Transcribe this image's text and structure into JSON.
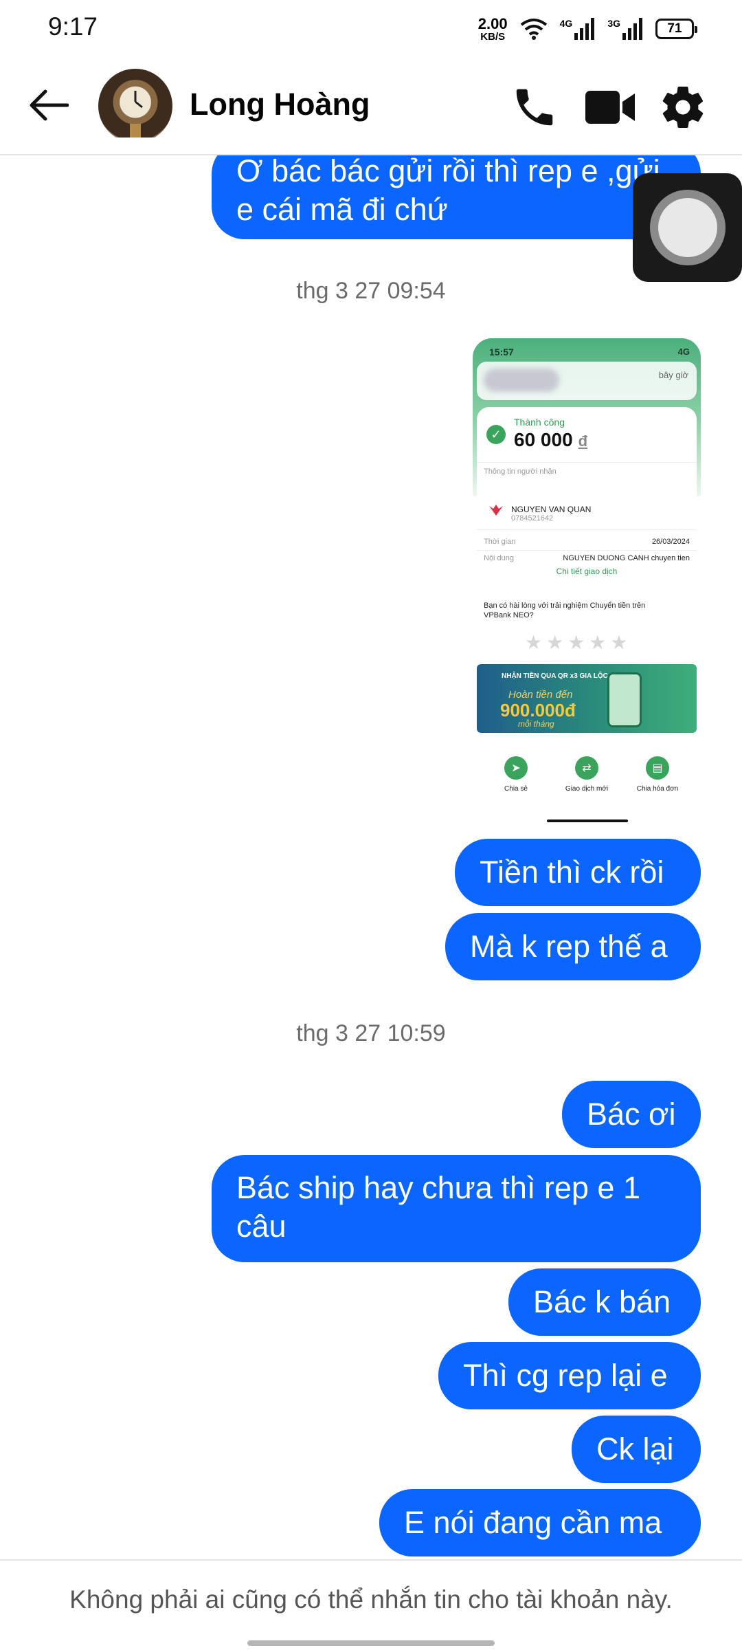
{
  "status_bar": {
    "time": "9:17",
    "net_speed_value": "2.00",
    "net_speed_unit": "KB/S",
    "signal_1": "4G",
    "signal_2": "3G",
    "battery": "71"
  },
  "header": {
    "contact_name": "Long Hoàng",
    "icons": [
      "back-arrow-icon",
      "phone-icon",
      "video-camera-icon",
      "gear-icon"
    ]
  },
  "messages": {
    "m1": {
      "line1": "Ơ bác bác gửi rồi thì rep e ,gửi",
      "line2": "e cái mã đi chứ"
    },
    "ts1": "thg 3 27 09:54",
    "attachment": {
      "status_time": "15:57",
      "status_network": "4G",
      "notif_ago": "bây giờ",
      "status": "Thành công",
      "amount": "60 000",
      "currency": "đ",
      "recipient_label": "Thông tin người nhận",
      "recipient_name": "NGUYEN VAN QUAN",
      "recipient_phone": "0784521642",
      "time_label": "Thời gian",
      "time_value": "26/03/2024",
      "content_label": "Nội dung",
      "content_value": "NGUYEN DUONG CANH chuyen tien",
      "detail_link": "Chi tiết giao dịch",
      "rating_question": "Bạn có hài lòng với trải nghiệm Chuyển tiền trên VPBank NEO?",
      "stars": "★★★★★",
      "banner_line1": "NHẬN TIỀN QUA QR x3 GIA LỘC",
      "banner_line2": "Hoàn tiền đến",
      "banner_amount": "900.000đ",
      "banner_line4": "mỗi tháng",
      "action_share": "Chia sẻ",
      "action_new": "Giao dịch mới",
      "action_split": "Chia hóa đơn"
    },
    "m2": "Tiền thì ck rồi",
    "m3": "Mà k rep thế a",
    "ts2": "thg 3 27 10:59",
    "m4": "Bác ơi",
    "m5": {
      "line1": "Bác ship hay chưa thì rep e 1",
      "line2": "câu"
    },
    "m6": "Bác k bán",
    "m7": "Thì cg rep lại e",
    "m8": "Ck lại",
    "m9": "E nói đang cần ma"
  },
  "footer": {
    "notice": "Không phải ai cũng có thể nhắn tin cho tài khoản này."
  },
  "colors": {
    "bubble": "#0a66ff",
    "timestamp": "#6b6b6b"
  }
}
